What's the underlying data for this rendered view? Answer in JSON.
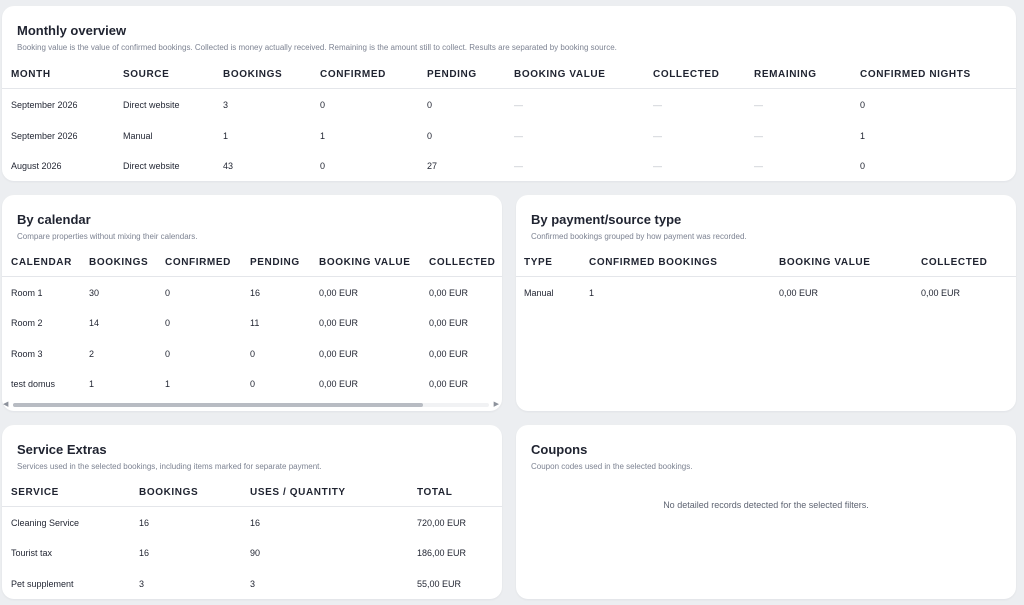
{
  "monthly": {
    "title": "Monthly overview",
    "subtitle": "Booking value is the value of confirmed bookings. Collected is money actually received. Remaining is the amount still to collect. Results are separated by booking source.",
    "columns": [
      "MONTH",
      "SOURCE",
      "BOOKINGS",
      "CONFIRMED",
      "PENDING",
      "BOOKING VALUE",
      "COLLECTED",
      "REMAINING",
      "CONFIRMED NIGHTS"
    ],
    "rows": [
      [
        "September 2026",
        "Direct website",
        "3",
        "0",
        "0",
        "—",
        "—",
        "—",
        "0"
      ],
      [
        "September 2026",
        "Manual",
        "1",
        "1",
        "0",
        "—",
        "—",
        "—",
        "1"
      ],
      [
        "August 2026",
        "Direct website",
        "43",
        "0",
        "27",
        "—",
        "—",
        "—",
        "0"
      ]
    ]
  },
  "calendar": {
    "title": "By calendar",
    "subtitle": "Compare properties without mixing their calendars.",
    "columns": [
      "CALENDAR",
      "BOOKINGS",
      "CONFIRMED",
      "PENDING",
      "BOOKING VALUE",
      "COLLECTED"
    ],
    "rows": [
      [
        "Room 1",
        "30",
        "0",
        "16",
        "0,00 EUR",
        "0,00 EUR"
      ],
      [
        "Room 2",
        "14",
        "0",
        "11",
        "0,00 EUR",
        "0,00 EUR"
      ],
      [
        "Room 3",
        "2",
        "0",
        "0",
        "0,00 EUR",
        "0,00 EUR"
      ],
      [
        "test domus",
        "1",
        "1",
        "0",
        "0,00 EUR",
        "0,00 EUR"
      ]
    ],
    "scroll_left_icon": "chevron-left",
    "scroll_right_icon": "chevron-right"
  },
  "payment": {
    "title": "By payment/source type",
    "subtitle": "Confirmed bookings grouped by how payment was recorded.",
    "columns": [
      "TYPE",
      "CONFIRMED BOOKINGS",
      "BOOKING VALUE",
      "COLLECTED"
    ],
    "rows": [
      [
        "Manual",
        "1",
        "0,00 EUR",
        "0,00 EUR"
      ]
    ]
  },
  "extras": {
    "title": "Service Extras",
    "subtitle": "Services used in the selected bookings, including items marked for separate payment.",
    "columns": [
      "SERVICE",
      "BOOKINGS",
      "USES / QUANTITY",
      "TOTAL"
    ],
    "rows": [
      [
        "Cleaning Service",
        "16",
        "16",
        "720,00 EUR"
      ],
      [
        "Tourist tax",
        "16",
        "90",
        "186,00 EUR"
      ],
      [
        "Pet supplement",
        "3",
        "3",
        "55,00 EUR"
      ]
    ]
  },
  "coupons": {
    "title": "Coupons",
    "subtitle": "Coupon codes used in the selected bookings.",
    "empty_message": "No detailed records detected for the selected filters."
  }
}
